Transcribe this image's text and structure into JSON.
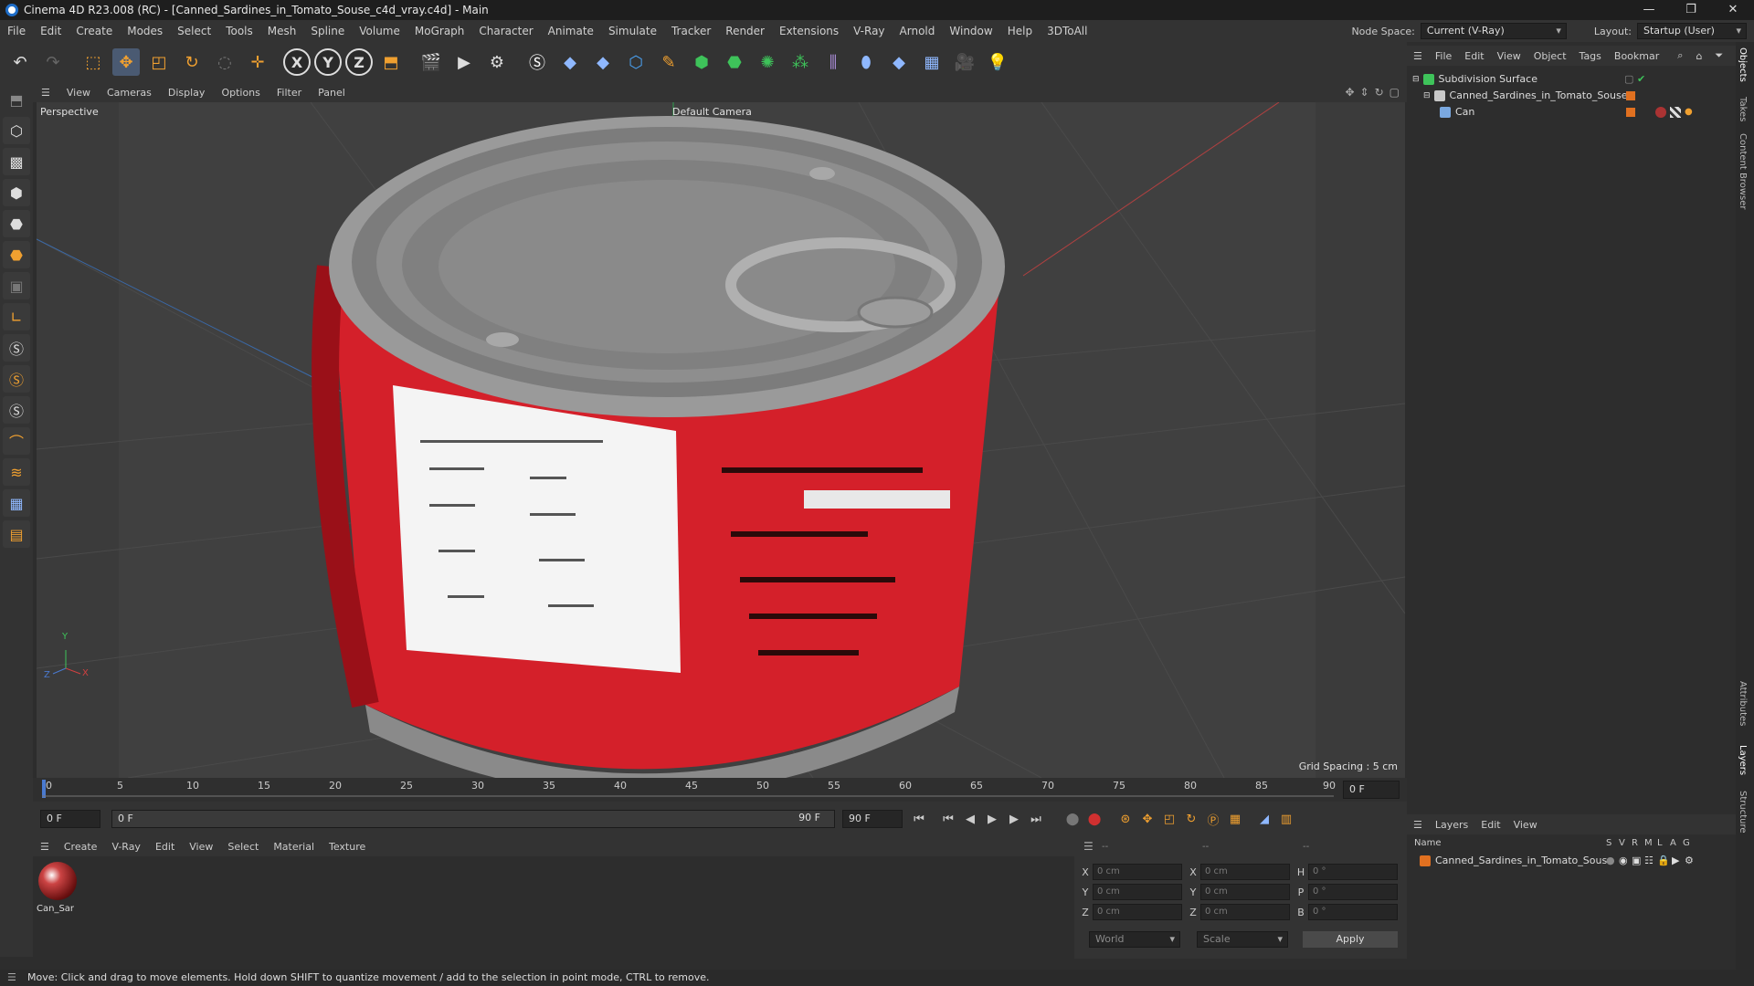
{
  "window": {
    "title": "Cinema 4D R23.008 (RC) - [Canned_Sardines_in_Tomato_Souse_c4d_vray.c4d] - Main",
    "controls": [
      "—",
      "❐",
      "✕"
    ]
  },
  "menubar": {
    "items": [
      "File",
      "Edit",
      "Create",
      "Modes",
      "Select",
      "Tools",
      "Mesh",
      "Spline",
      "Volume",
      "MoGraph",
      "Character",
      "Animate",
      "Simulate",
      "Tracker",
      "Render",
      "Extensions",
      "V-Ray",
      "Arnold",
      "Window",
      "Help",
      "3DToAll"
    ],
    "node_space_label": "Node Space:",
    "node_space_value": "Current (V-Ray)",
    "layout_label": "Layout:",
    "layout_value": "Startup (User)"
  },
  "toolbar": {
    "axis_x": "X",
    "axis_y": "Y",
    "axis_z": "Z"
  },
  "viewport": {
    "menu": [
      "View",
      "Cameras",
      "Display",
      "Options",
      "Filter",
      "Panel"
    ],
    "name": "Perspective",
    "camera": "Default Camera",
    "grid_spacing": "Grid Spacing : 5 cm",
    "axes": {
      "x": "X",
      "y": "Y",
      "z": "Z"
    }
  },
  "timeline": {
    "ticks": [
      "0",
      "5",
      "10",
      "15",
      "20",
      "25",
      "30",
      "35",
      "40",
      "45",
      "50",
      "55",
      "60",
      "65",
      "70",
      "75",
      "80",
      "85",
      "90"
    ],
    "current_frame": "0 F",
    "start": "0 F",
    "range_start": "0 F",
    "range_end": "90 F",
    "end": "90 F"
  },
  "materials": {
    "menu": [
      "Create",
      "V-Ray",
      "Edit",
      "View",
      "Select",
      "Material",
      "Texture"
    ],
    "items": [
      {
        "name": "Can_Sar"
      }
    ]
  },
  "coordinates": {
    "header": [
      "--",
      "--",
      "--"
    ],
    "rows": [
      {
        "a": "X",
        "av": "0 cm",
        "b": "X",
        "bv": "0 cm",
        "c": "H",
        "cv": "0 °"
      },
      {
        "a": "Y",
        "av": "0 cm",
        "b": "Y",
        "bv": "0 cm",
        "c": "P",
        "cv": "0 °"
      },
      {
        "a": "Z",
        "av": "0 cm",
        "b": "Z",
        "bv": "0 cm",
        "c": "B",
        "cv": "0 °"
      }
    ],
    "mode": "World",
    "transform": "Scale",
    "apply": "Apply"
  },
  "objects": {
    "menu": [
      "File",
      "Edit",
      "View",
      "Object",
      "Tags",
      "Bookmar"
    ],
    "items": [
      {
        "name": "Subdivision Surface",
        "color": "#3ec35a"
      },
      {
        "name": "Canned_Sardines_in_Tomato_Souse",
        "color": "#c8c8c8"
      },
      {
        "name": "Can",
        "color": "#7aa8e0"
      }
    ]
  },
  "layers": {
    "menu": [
      "Layers",
      "Edit",
      "View"
    ],
    "col_name": "Name",
    "cols": [
      "S",
      "V",
      "R",
      "M",
      "L",
      "A",
      "G"
    ],
    "items": [
      {
        "name": "Canned_Sardines_in_Tomato_Souse",
        "color": "#e07020"
      }
    ]
  },
  "side_tabs": [
    "Objects",
    "Takes",
    "Content Browser",
    "Attributes",
    "Layers",
    "Structure"
  ],
  "status": "Move: Click and drag to move elements. Hold down SHIFT to quantize movement / add to the selection in point mode, CTRL to remove."
}
